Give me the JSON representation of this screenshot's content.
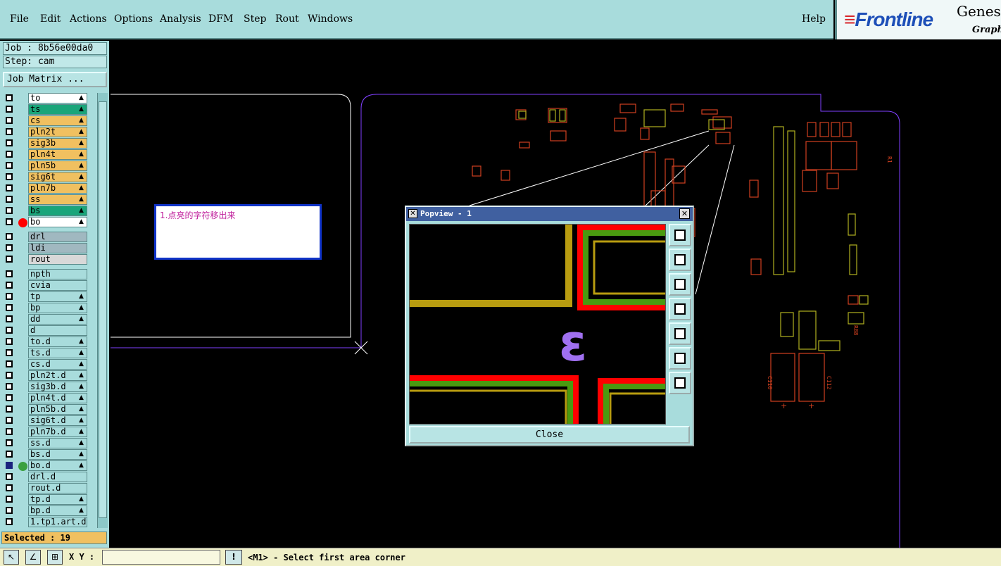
{
  "menubar": {
    "items": [
      {
        "label": "File"
      },
      {
        "label": "Edit"
      },
      {
        "label": "Actions"
      },
      {
        "label": "Options"
      },
      {
        "label": "Analysis"
      },
      {
        "label": "DFM"
      },
      {
        "label": "Step"
      },
      {
        "label": "Rout"
      },
      {
        "label": "Windows"
      }
    ],
    "help": "Help"
  },
  "logo": {
    "brand": "Frontline",
    "product": "Genes",
    "sub": "Graphi"
  },
  "job": {
    "job_line": "Job : 8b56e00da0",
    "step_line": "Step: cam",
    "matrix_button": "Job Matrix ..."
  },
  "layers": [
    {
      "name": "to",
      "color": "#ffffff",
      "checked": false,
      "flag": true
    },
    {
      "name": "ts",
      "color": "#1aa57a",
      "checked": false,
      "flag": true
    },
    {
      "name": "cs",
      "color": "#f0c060",
      "checked": false,
      "flag": true
    },
    {
      "name": "pln2t",
      "color": "#f0c060",
      "checked": false,
      "flag": true
    },
    {
      "name": "sig3b",
      "color": "#f0c060",
      "checked": false,
      "flag": true
    },
    {
      "name": "pln4t",
      "color": "#f0c060",
      "checked": false,
      "flag": true
    },
    {
      "name": "pln5b",
      "color": "#f0c060",
      "checked": false,
      "flag": true
    },
    {
      "name": "sig6t",
      "color": "#f0c060",
      "checked": false,
      "flag": true
    },
    {
      "name": "pln7b",
      "color": "#f0c060",
      "checked": false,
      "flag": true
    },
    {
      "name": "ss",
      "color": "#f0c060",
      "checked": false,
      "flag": true
    },
    {
      "name": "bs",
      "color": "#1aa57a",
      "checked": false,
      "flag": true
    },
    {
      "name": "bo",
      "color": "#ffffff",
      "checked": false,
      "flag": true,
      "dot": "#ff0000"
    },
    {
      "name": "drl",
      "color": "#a0b8c0",
      "checked": false,
      "flag": false,
      "gap": true
    },
    {
      "name": "ldi",
      "color": "#a0b8c0",
      "checked": false,
      "flag": false
    },
    {
      "name": "rout",
      "color": "#d8d8d8",
      "checked": false,
      "flag": false
    },
    {
      "name": "npth",
      "color": "#a8dcdc",
      "checked": false,
      "flag": false,
      "gap": true
    },
    {
      "name": "cvia",
      "color": "#a8dcdc",
      "checked": false,
      "flag": false
    },
    {
      "name": "tp",
      "color": "#a8dcdc",
      "checked": false,
      "flag": true
    },
    {
      "name": "bp",
      "color": "#a8dcdc",
      "checked": false,
      "flag": true
    },
    {
      "name": "dd",
      "color": "#a8dcdc",
      "checked": false,
      "flag": true
    },
    {
      "name": "d",
      "color": "#a8dcdc",
      "checked": false,
      "flag": false
    },
    {
      "name": "to.d",
      "color": "#a8dcdc",
      "checked": false,
      "flag": true
    },
    {
      "name": "ts.d",
      "color": "#a8dcdc",
      "checked": false,
      "flag": true
    },
    {
      "name": "cs.d",
      "color": "#a8dcdc",
      "checked": false,
      "flag": true
    },
    {
      "name": "pln2t.d",
      "color": "#a8dcdc",
      "checked": false,
      "flag": true
    },
    {
      "name": "sig3b.d",
      "color": "#a8dcdc",
      "checked": false,
      "flag": true
    },
    {
      "name": "pln4t.d",
      "color": "#a8dcdc",
      "checked": false,
      "flag": true
    },
    {
      "name": "pln5b.d",
      "color": "#a8dcdc",
      "checked": false,
      "flag": true
    },
    {
      "name": "sig6t.d",
      "color": "#a8dcdc",
      "checked": false,
      "flag": true
    },
    {
      "name": "pln7b.d",
      "color": "#a8dcdc",
      "checked": false,
      "flag": true
    },
    {
      "name": "ss.d",
      "color": "#a8dcdc",
      "checked": false,
      "flag": true
    },
    {
      "name": "bs.d",
      "color": "#a8dcdc",
      "checked": false,
      "flag": true
    },
    {
      "name": "bo.d",
      "color": "#a8dcdc",
      "checked": true,
      "flag": true,
      "dot": "#3aa040"
    },
    {
      "name": "drl.d",
      "color": "#a8dcdc",
      "checked": false,
      "flag": false
    },
    {
      "name": "rout.d",
      "color": "#a8dcdc",
      "checked": false,
      "flag": false
    },
    {
      "name": "tp.d",
      "color": "#a8dcdc",
      "checked": false,
      "flag": true
    },
    {
      "name": "bp.d",
      "color": "#a8dcdc",
      "checked": false,
      "flag": true
    },
    {
      "name": "1.tp1.art.d",
      "color": "#a8dcdc",
      "checked": false,
      "flag": false
    }
  ],
  "selected": "Selected : 19",
  "note": "1.点亮的字符移出来",
  "popview": {
    "title": "Popview - 1",
    "close_label": "Close",
    "glyph": "ε",
    "tools": [
      "zoom-window-icon",
      "pan-up-icon",
      "pan-down-icon",
      "pan-left-icon",
      "pan-right-icon",
      "zoom-home-icon",
      "zoom-fit-icon"
    ]
  },
  "statusbar": {
    "xy_label": "X Y :",
    "xy_value": "",
    "warn": "!",
    "prompt": "<M1> - Select first area corner"
  }
}
